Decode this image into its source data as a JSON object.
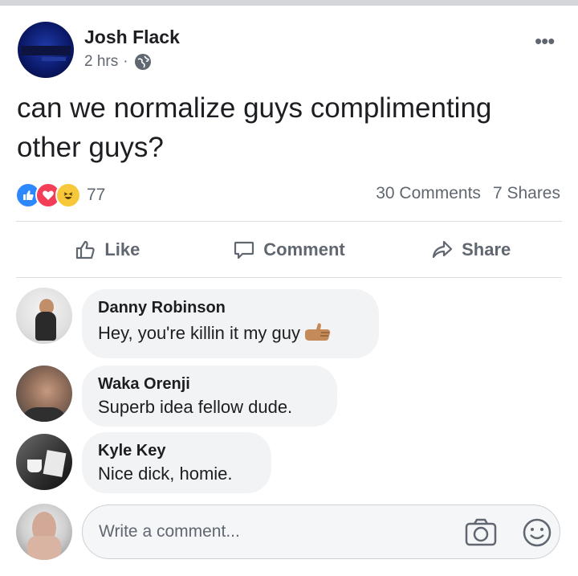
{
  "post": {
    "author": "Josh Flack",
    "time": "2 hrs",
    "separator": "·",
    "privacy_icon": "globe-icon",
    "more_label": "•••",
    "text": "can we normalize guys complimenting other guys?",
    "reactions": {
      "icons": [
        "like-reaction-icon",
        "love-reaction-icon",
        "haha-reaction-icon"
      ],
      "count": "77"
    },
    "comments_count": "30 Comments",
    "shares_count": "7 Shares"
  },
  "actions": {
    "like": "Like",
    "comment": "Comment",
    "share": "Share"
  },
  "comments": [
    {
      "name": "Danny Robinson",
      "text": "Hey, you're killin it my guy",
      "emoji": "thumbs-up-emoji"
    },
    {
      "name": "Waka Orenji",
      "text": "Superb idea fellow dude."
    },
    {
      "name": "Kyle Key",
      "text": "Nice dick, homie."
    }
  ],
  "composer": {
    "placeholder": "Write a comment...",
    "icons": [
      "camera-icon",
      "smiley-icon"
    ]
  },
  "colors": {
    "like_blue": "#2d88ff",
    "love_red": "#f33e58",
    "haha_yellow": "#f7c93a",
    "secondary_text": "#606770",
    "bubble_bg": "#f2f3f5"
  }
}
